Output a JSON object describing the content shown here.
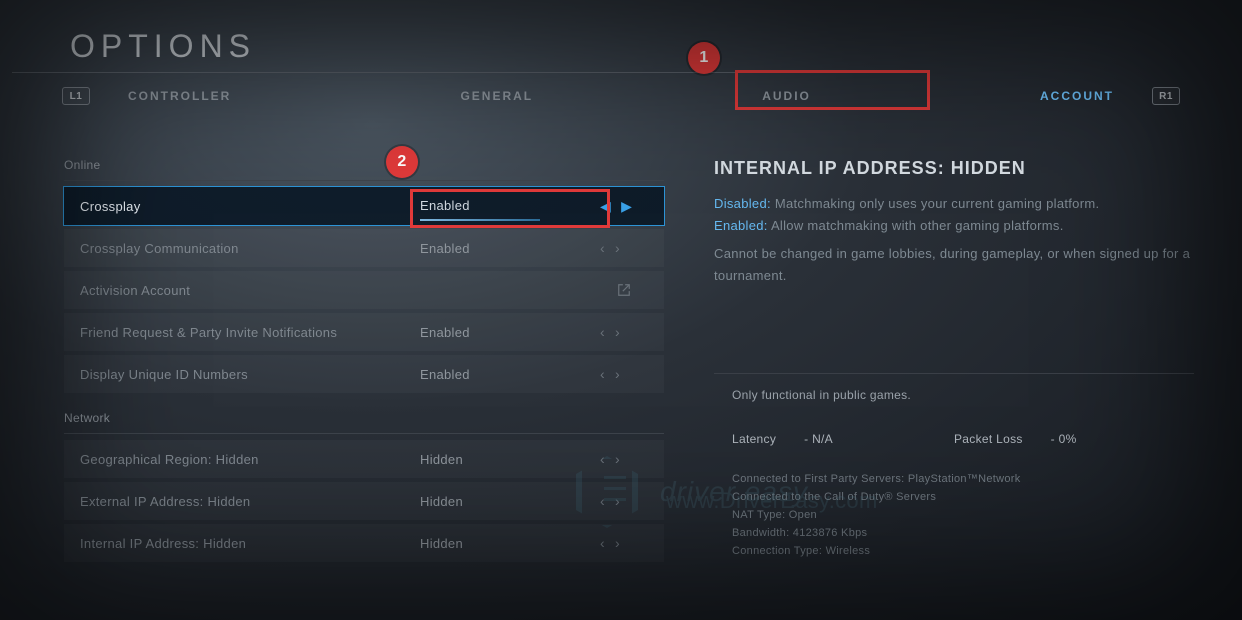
{
  "title": "OPTIONS",
  "bumpers": {
    "left": "L1",
    "right": "R1"
  },
  "tabs": [
    "CONTROLLER",
    "GENERAL",
    "AUDIO",
    "ACCOUNT"
  ],
  "activeTabIndex": 3,
  "annotations": {
    "badge1": "1",
    "badge2": "2"
  },
  "sections": [
    {
      "label": "Online",
      "rows": [
        {
          "label": "Crossplay",
          "value": "Enabled",
          "type": "toggle",
          "selected": true
        },
        {
          "label": "Crossplay Communication",
          "value": "Enabled",
          "type": "toggle"
        },
        {
          "label": "Activision Account",
          "value": "",
          "type": "link"
        },
        {
          "label": "Friend Request & Party Invite Notifications",
          "value": "Enabled",
          "type": "toggle"
        },
        {
          "label": "Display Unique ID Numbers",
          "value": "Enabled",
          "type": "toggle"
        }
      ]
    },
    {
      "label": "Network",
      "rows": [
        {
          "label": "Geographical Region: Hidden",
          "value": "Hidden",
          "type": "toggle"
        },
        {
          "label": "External IP Address: Hidden",
          "value": "Hidden",
          "type": "toggle"
        },
        {
          "label": "Internal IP Address: Hidden",
          "value": "Hidden",
          "type": "toggle"
        }
      ]
    }
  ],
  "detail": {
    "heading": "INTERNAL IP ADDRESS: HIDDEN",
    "disabledLabel": "Disabled:",
    "disabledText": "Matchmaking only uses your current gaming platform.",
    "enabledLabel": "Enabled:",
    "enabledText": "Allow matchmaking with other gaming platforms.",
    "note": "Cannot be changed in game lobbies, during gameplay, or when signed up for a tournament."
  },
  "network": {
    "note": "Only functional in public games.",
    "latencyLabel": "Latency",
    "latencyValue": "- N/A",
    "packetLossLabel": "Packet Loss",
    "packetLossValue": "- 0%",
    "lines": [
      "Connected to First Party Servers: PlayStation™Network",
      "Connected to the Call of Duty® Servers",
      "NAT Type: Open",
      "Bandwidth: 4123876 Kbps",
      "Connection Type: Wireless"
    ]
  },
  "watermark": {
    "brand": "driver easy",
    "url": "www.DriverEasy.com"
  }
}
